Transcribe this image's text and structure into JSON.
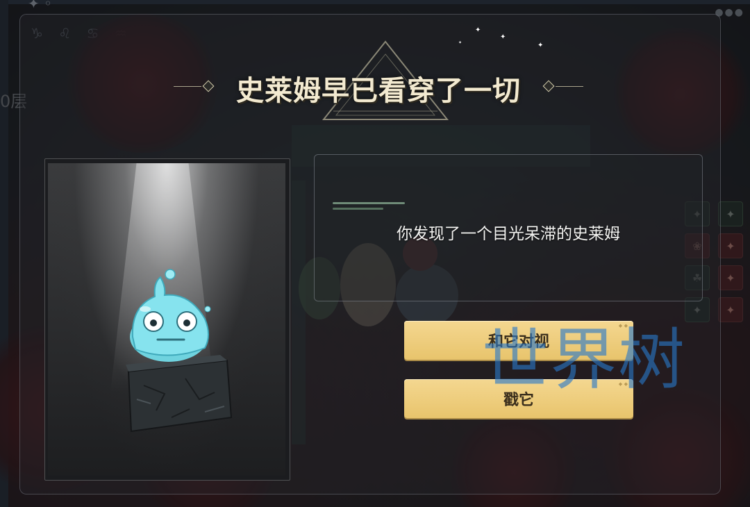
{
  "hud": {
    "floor_label": "0层",
    "zodiac_icons": "♑ ♌ ♋ ♒",
    "skill_icons": [
      "✦",
      "✦",
      "❀",
      "✦",
      "☘",
      "✦",
      "✦",
      "✦"
    ]
  },
  "event": {
    "title": "史莱姆早已看穿了一切",
    "message": "你发现了一个目光呆滞的史莱姆",
    "options": [
      {
        "label": "和它对视"
      },
      {
        "label": "戳它"
      }
    ]
  },
  "watermark": {
    "text": "世界树"
  },
  "colors": {
    "button_fill": "#f0cf82",
    "title_text": "#f3ead0",
    "slime": "#7fdde8",
    "watermark": "#2878c8"
  },
  "icons": [
    "slime-icon",
    "stone-pedestal-icon",
    "triangle-sigil-icon",
    "diamond-ornament-icon"
  ]
}
